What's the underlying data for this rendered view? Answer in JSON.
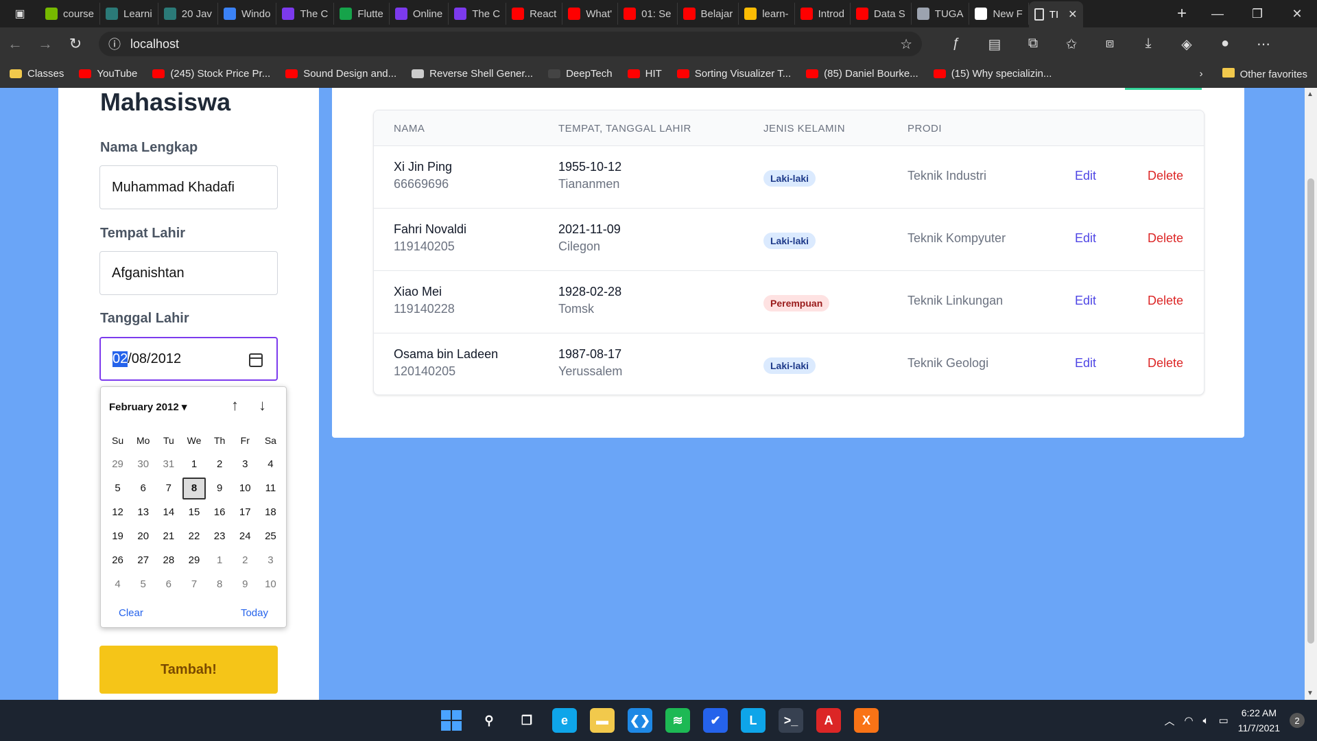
{
  "browser": {
    "tabs": [
      {
        "label": "course",
        "color": "#76b900"
      },
      {
        "label": "Learni",
        "color": "#2b7a78"
      },
      {
        "label": "20 Jav",
        "color": "#2b7a78"
      },
      {
        "label": "Windo",
        "color": "#3b82f6"
      },
      {
        "label": "The C",
        "color": "#7c3aed"
      },
      {
        "label": "Flutte",
        "color": "#16a34a"
      },
      {
        "label": "Online",
        "color": "#7c3aed"
      },
      {
        "label": "The C",
        "color": "#7c3aed"
      },
      {
        "label": "React",
        "color": "#ff0000"
      },
      {
        "label": "What'",
        "color": "#ff0000"
      },
      {
        "label": "01: Se",
        "color": "#ff0000"
      },
      {
        "label": "Belajar",
        "color": "#ff0000"
      },
      {
        "label": "learn-",
        "color": "#fbbc04"
      },
      {
        "label": "Introd",
        "color": "#ff0000"
      },
      {
        "label": "Data S",
        "color": "#ff0000"
      },
      {
        "label": "TUGA",
        "color": "#9ca3af"
      },
      {
        "label": "New F",
        "color": "#ffffff"
      }
    ],
    "active_tab": "TI",
    "address": "localhost",
    "bookmarks": [
      {
        "label": "Classes",
        "color": "#f2c94c"
      },
      {
        "label": "YouTube",
        "color": "#ff0000"
      },
      {
        "label": "(245) Stock Price Pr...",
        "color": "#ff0000"
      },
      {
        "label": "Sound Design and...",
        "color": "#ff0000"
      },
      {
        "label": "Reverse Shell Gener...",
        "color": "#cccccc"
      },
      {
        "label": "DeepTech",
        "color": "#444444"
      },
      {
        "label": "HIT",
        "color": "#ff0000"
      },
      {
        "label": "Sorting Visualizer T...",
        "color": "#ff0000"
      },
      {
        "label": "(85) Daniel Bourke...",
        "color": "#ff0000"
      },
      {
        "label": "(15) Why specializin...",
        "color": "#ff0000"
      }
    ],
    "other_favorites": "Other favorites"
  },
  "form": {
    "title": "Mahasiswa",
    "name_label": "Nama Lengkap",
    "name_value": "Muhammad Khadafi",
    "place_label": "Tempat Lahir",
    "place_value": "Afganishtan",
    "date_label": "Tanggal Lahir",
    "date_selected_part": "02",
    "date_rest": "/08/2012",
    "submit_label": "Tambah!"
  },
  "datepicker": {
    "month_label": "February 2012",
    "weekdays": [
      "Su",
      "Mo",
      "Tu",
      "We",
      "Th",
      "Fr",
      "Sa"
    ],
    "days": [
      [
        "29",
        "other"
      ],
      [
        "30",
        "other"
      ],
      [
        "31",
        "other"
      ],
      [
        "1",
        ""
      ],
      [
        "2",
        ""
      ],
      [
        "3",
        ""
      ],
      [
        "4",
        ""
      ],
      [
        "5",
        ""
      ],
      [
        "6",
        ""
      ],
      [
        "7",
        ""
      ],
      [
        "8",
        "today"
      ],
      [
        "9",
        ""
      ],
      [
        "10",
        ""
      ],
      [
        "11",
        ""
      ],
      [
        "12",
        ""
      ],
      [
        "13",
        ""
      ],
      [
        "14",
        ""
      ],
      [
        "15",
        ""
      ],
      [
        "16",
        ""
      ],
      [
        "17",
        ""
      ],
      [
        "18",
        ""
      ],
      [
        "19",
        ""
      ],
      [
        "20",
        ""
      ],
      [
        "21",
        ""
      ],
      [
        "22",
        ""
      ],
      [
        "23",
        ""
      ],
      [
        "24",
        ""
      ],
      [
        "25",
        ""
      ],
      [
        "26",
        ""
      ],
      [
        "27",
        ""
      ],
      [
        "28",
        ""
      ],
      [
        "29",
        ""
      ],
      [
        "1",
        "other"
      ],
      [
        "2",
        "other"
      ],
      [
        "3",
        "other"
      ],
      [
        "4",
        "other"
      ],
      [
        "5",
        "other"
      ],
      [
        "6",
        "other"
      ],
      [
        "7",
        "other"
      ],
      [
        "8",
        "other"
      ],
      [
        "9",
        "other"
      ],
      [
        "10",
        "other"
      ]
    ],
    "clear_label": "Clear",
    "today_label": "Today"
  },
  "table": {
    "headers": {
      "nama": "NAMA",
      "ttl": "TEMPAT, TANGGAL LAHIR",
      "jk": "JENIS KELAMIN",
      "prodi": "PRODI"
    },
    "rows": [
      {
        "name": "Xi Jin Ping",
        "nim": "66669696",
        "date": "1955-10-12",
        "place": "Tiananmen",
        "gender": "Laki-laki",
        "gender_type": "male",
        "prodi": "Teknik Industri",
        "edit": "Edit",
        "delete": "Delete"
      },
      {
        "name": "Fahri Novaldi",
        "nim": "119140205",
        "date": "2021-11-09",
        "place": "Cilegon",
        "gender": "Laki-laki",
        "gender_type": "male",
        "prodi": "Teknik Kompyuter",
        "edit": "Edit",
        "delete": "Delete"
      },
      {
        "name": "Xiao Mei",
        "nim": "119140228",
        "date": "1928-02-28",
        "place": "Tomsk",
        "gender": "Perempuan",
        "gender_type": "female",
        "prodi": "Teknik Linkungan",
        "edit": "Edit",
        "delete": "Delete"
      },
      {
        "name": "Osama bin Ladeen",
        "nim": "120140205",
        "date": "1987-08-17",
        "place": "Yerussalem",
        "gender": "Laki-laki",
        "gender_type": "male",
        "prodi": "Teknik Geologi",
        "edit": "Edit",
        "delete": "Delete"
      }
    ]
  },
  "taskbar": {
    "apps": [
      {
        "name": "windows-start-icon",
        "glyph": "",
        "color": "#3b82f6"
      },
      {
        "name": "search-icon",
        "glyph": "⚲",
        "color": "transparent"
      },
      {
        "name": "task-view-icon",
        "glyph": "❐",
        "color": "transparent"
      },
      {
        "name": "edge-icon",
        "glyph": "e",
        "color": "#0ea5e9"
      },
      {
        "name": "file-explorer-icon",
        "glyph": "▬",
        "color": "#f2c94c"
      },
      {
        "name": "vscode-icon",
        "glyph": "❮❯",
        "color": "#1e88e5"
      },
      {
        "name": "spotify-icon",
        "glyph": "≋",
        "color": "#1db954"
      },
      {
        "name": "todo-icon",
        "glyph": "✔",
        "color": "#2563eb"
      },
      {
        "name": "l-app-icon",
        "glyph": "L",
        "color": "#0ea5e9"
      },
      {
        "name": "terminal-icon",
        "glyph": ">_",
        "color": "#374151"
      },
      {
        "name": "acrobat-icon",
        "glyph": "A",
        "color": "#dc2626"
      },
      {
        "name": "xampp-icon",
        "glyph": "X",
        "color": "#f97316"
      }
    ],
    "time": "6:22 AM",
    "date": "11/7/2021",
    "notifications": "2"
  }
}
